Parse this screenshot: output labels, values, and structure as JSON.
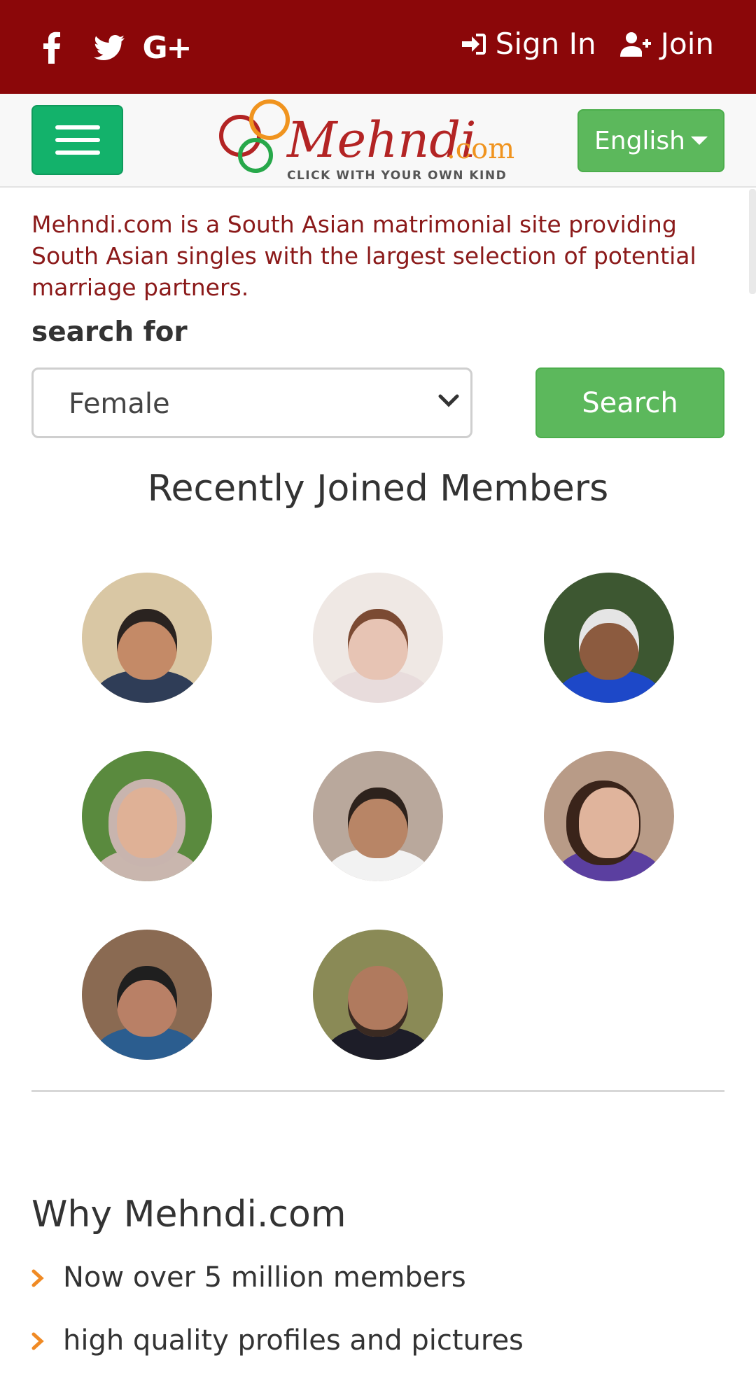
{
  "topbar": {
    "social": [
      {
        "name": "facebook-icon"
      },
      {
        "name": "twitter-icon"
      },
      {
        "name": "google-plus-icon",
        "glyph": "G+"
      }
    ],
    "sign_in": "Sign In",
    "join": "Join"
  },
  "navbar": {
    "logo_text": "Mehndi",
    "logo_suffix": ".com",
    "logo_tagline": "CLICK WITH YOUR OWN KIND",
    "language": "English"
  },
  "intro": "Mehndi.com is a South Asian matrimonial site providing South Asian singles with the largest selection of potential marriage partners.",
  "search": {
    "label": "search for",
    "selected": "Female",
    "button": "Search"
  },
  "recent": {
    "title": "Recently Joined Members"
  },
  "why": {
    "title": "Why Mehndi.com",
    "items": [
      "Now over 5 million members",
      "high quality profiles and pictures"
    ]
  },
  "colors": {
    "topbar": "#8b0709",
    "menu_button": "#13b26b",
    "green_button": "#5cb85c",
    "intro_text": "#8b1a1a",
    "bullet": "#f08a24"
  }
}
